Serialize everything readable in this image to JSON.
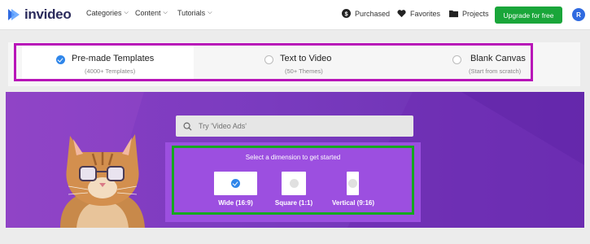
{
  "nav": {
    "brand": "invideo",
    "menu": [
      {
        "label": "Categories"
      },
      {
        "label": "Content"
      },
      {
        "label": "Tutorials"
      }
    ],
    "purchased": "Purchased",
    "favorites": "Favorites",
    "projects": "Projects",
    "upgrade": "Upgrade for free",
    "avatar_initial": "R"
  },
  "modes": [
    {
      "title": "Pre-made Templates",
      "subtitle": "(4000+ Templates)",
      "selected": true
    },
    {
      "title": "Text to Video",
      "subtitle": "(50+ Themes)",
      "selected": false
    },
    {
      "title": "Blank Canvas",
      "subtitle": "(Start from scratch)",
      "selected": false
    }
  ],
  "search": {
    "placeholder": "Try 'Video Ads'"
  },
  "dimensions": {
    "title": "Select a dimension to get started",
    "options": [
      {
        "label": "Wide (16:9)",
        "selected": true
      },
      {
        "label": "Square (1:1)",
        "selected": false
      },
      {
        "label": "Vertical (9:16)",
        "selected": false
      }
    ]
  },
  "colors": {
    "accent_blue": "#2f86ea",
    "upgrade_green": "#1aa63a",
    "hero_purple": "#8a3fc4",
    "highlight_magenta": "#b815b8",
    "highlight_green": "#16a81f"
  }
}
